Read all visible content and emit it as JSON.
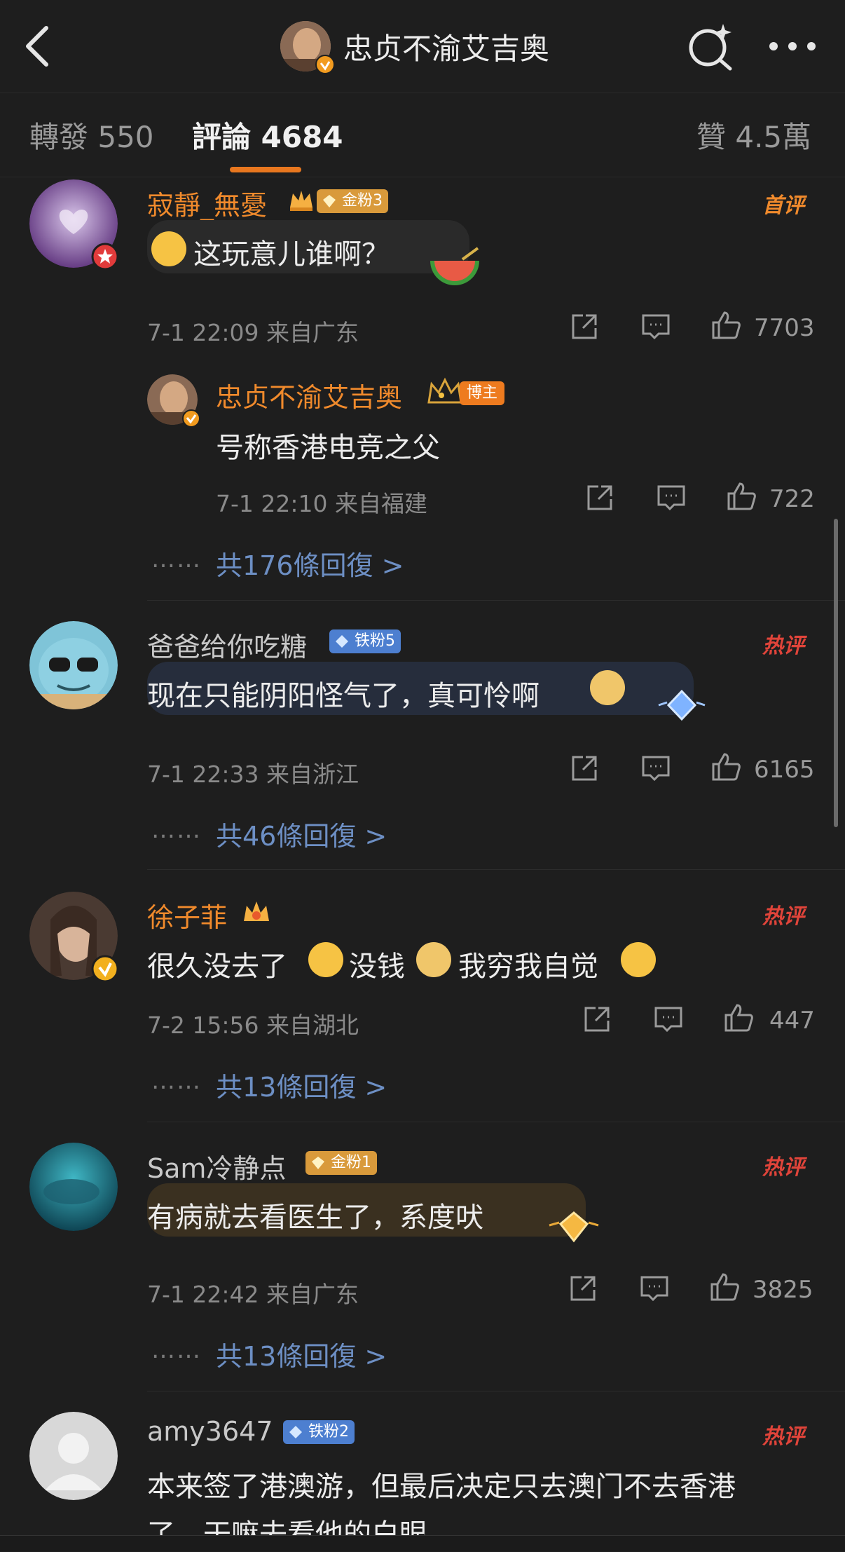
{
  "header": {
    "title": "忠贞不渝艾吉奥",
    "back_icon": "chevron-left-icon",
    "search_icon": "search-sparkle-icon",
    "more_icon": "more-dots-icon"
  },
  "tabs": {
    "repost": "轉發 550",
    "comments": "評論 4684",
    "likes": "贊 4.5萬"
  },
  "colors": {
    "accent": "#e8771f",
    "link": "#6d8fc4",
    "hot": "#e0443a",
    "bg": "#1e1e1e"
  },
  "comments": [
    {
      "username": "寂靜_無憂",
      "badge": "金粉3",
      "tag": "首评",
      "text": "这玩意儿谁啊？",
      "meta": "7-1 22:09  来自广东",
      "likes": "7703",
      "reply": {
        "username": "忠贞不渝艾吉奥",
        "badge": "博主",
        "text": "号称香港电竞之父",
        "meta": "7-1 22:10  来自福建",
        "likes": "722"
      },
      "dots": "……",
      "replies": "共176條回復 >"
    },
    {
      "username": "爸爸给你吃糖",
      "badge": "铁粉5",
      "tag": "热评",
      "text": "现在只能阴阳怪气了，真可怜啊",
      "meta": "7-1 22:33  来自浙江",
      "likes": "6165",
      "dots": "……",
      "replies": "共46條回復 >"
    },
    {
      "username": "徐子菲",
      "tag": "热评",
      "text_parts": [
        "很久没去了",
        "没钱",
        "我穷我自觉"
      ],
      "meta": "7-2 15:56  来自湖北",
      "likes": "447",
      "dots": "……",
      "replies": "共13條回復 >"
    },
    {
      "username": "Sam冷静点",
      "badge": "金粉1",
      "tag": "热评",
      "text": "有病就去看医生了，系度吠",
      "meta": "7-1 22:42  来自广东",
      "likes": "3825",
      "dots": "……",
      "replies": "共13條回復 >"
    },
    {
      "username": "amy3647",
      "badge": "铁粉2",
      "tag": "热评",
      "text_line1": "本来签了港澳游，但最后决定只去澳门不去香港",
      "text_line2": "了。干嘛去看他的白眼。"
    }
  ]
}
